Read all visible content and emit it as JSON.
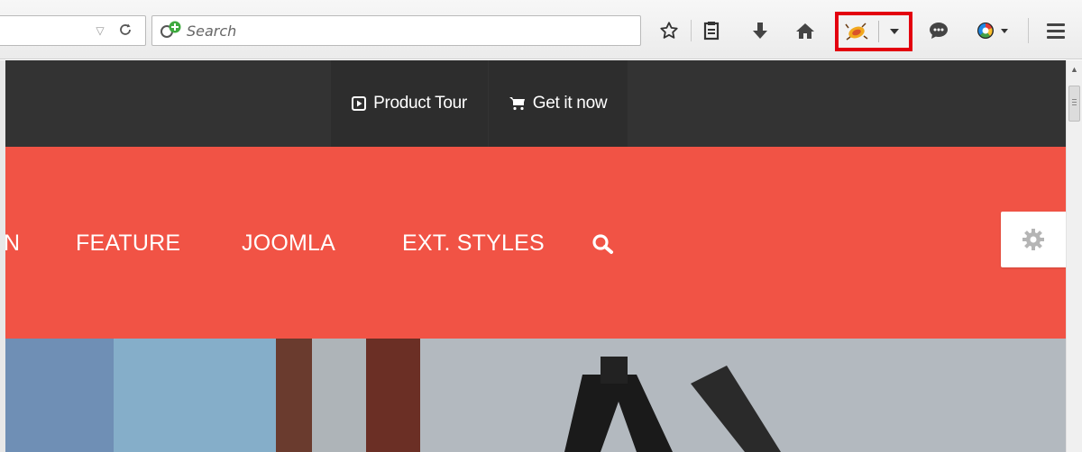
{
  "browser": {
    "search": {
      "placeholder": "Search"
    },
    "urlbar": {
      "dropdown_icon": "triangle-down-icon",
      "reload_icon": "reload-icon"
    },
    "toolbar_icons": [
      "star-icon",
      "reading-list-icon",
      "download-icon",
      "home-icon",
      "firebug-icon",
      "dropdown-arrow-icon",
      "chat-icon",
      "color-wheel-icon",
      "hamburger-menu-icon"
    ],
    "highlight_color": "#e3000f"
  },
  "site": {
    "top_nav": [
      {
        "label": "Product Tour",
        "icon": "play-square-icon"
      },
      {
        "label": "Get it now",
        "icon": "cart-icon"
      }
    ],
    "main_nav": [
      {
        "label": "N"
      },
      {
        "label": "FEATURE"
      },
      {
        "label": "JOOMLA"
      },
      {
        "label": "EXT. STYLES"
      }
    ],
    "colors": {
      "topbar": "#333333",
      "accent": "#f15345",
      "text": "#ffffff"
    }
  }
}
